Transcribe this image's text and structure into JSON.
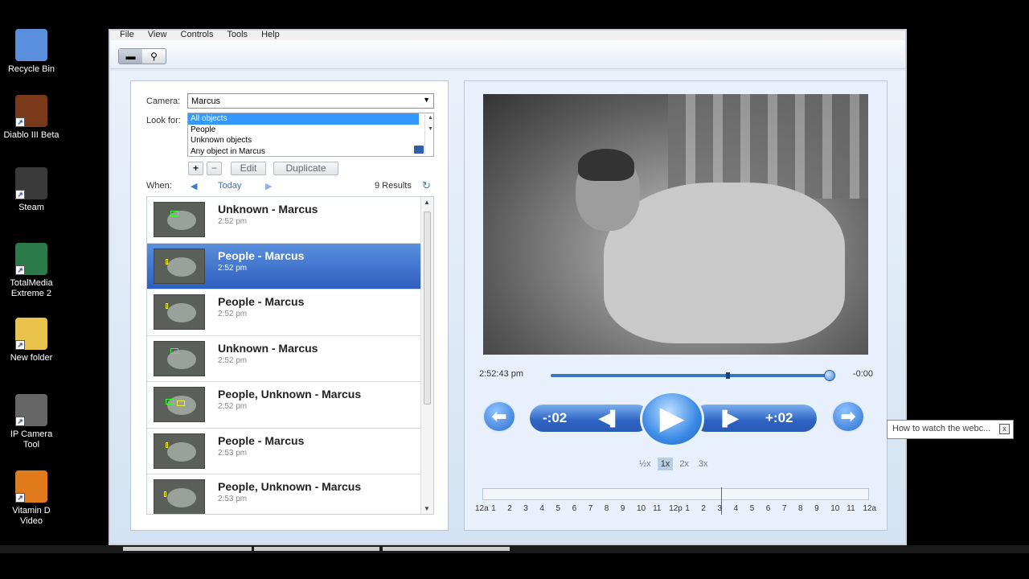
{
  "desktop_icons": [
    {
      "label": "Recycle Bin",
      "icon": "recycle-bin-icon",
      "color": "#5a8fdd"
    },
    {
      "label": "Diablo III Beta",
      "icon": "diablo-icon",
      "color": "#7a3a1a"
    },
    {
      "label": "Steam",
      "icon": "steam-icon",
      "color": "#3a3a3a"
    },
    {
      "label": "TotalMedia Extreme 2",
      "icon": "totalmedia-icon",
      "color": "#2a7a4a"
    },
    {
      "label": "New folder",
      "icon": "folder-icon",
      "color": "#e8c24a"
    },
    {
      "label": "IP Camera Tool",
      "icon": "ip-camera-tool-icon",
      "color": "#666"
    },
    {
      "label": "Vitamin D Video",
      "icon": "vitamin-d-icon",
      "color": "#e07a1a"
    }
  ],
  "menu": [
    "File",
    "View",
    "Controls",
    "Tools",
    "Help"
  ],
  "filters": {
    "camera_label": "Camera:",
    "camera_value": "Marcus",
    "lookfor_label": "Look for:",
    "lookfor_options": [
      "All objects",
      "People",
      "Unknown objects",
      "Any object in Marcus"
    ],
    "add": "+",
    "remove": "−",
    "edit": "Edit",
    "duplicate": "Duplicate",
    "when_label": "When:",
    "when_value": "Today",
    "results_count": "9 Results"
  },
  "events": [
    {
      "title": "Unknown - Marcus",
      "time": "2:52 pm"
    },
    {
      "title": "People - Marcus",
      "time": "2:52 pm"
    },
    {
      "title": "People - Marcus",
      "time": "2:52 pm"
    },
    {
      "title": "Unknown - Marcus",
      "time": "2:52 pm"
    },
    {
      "title": "People, Unknown - Marcus",
      "time": "2:52 pm"
    },
    {
      "title": "People - Marcus",
      "time": "2:53 pm"
    },
    {
      "title": "People, Unknown - Marcus",
      "time": "2:53 pm"
    }
  ],
  "player": {
    "current_time": "2:52:43 pm",
    "remaining": "-0:00",
    "progress": 1.0,
    "back_label": "-:02",
    "fwd_label": "+:02",
    "speeds": [
      "½x",
      "1x",
      "2x",
      "3x"
    ],
    "active_speed": "1x"
  },
  "timeline_hours": [
    "12a",
    "1",
    "2",
    "3",
    "4",
    "5",
    "6",
    "7",
    "8",
    "9",
    "10",
    "11",
    "12p",
    "1",
    "2",
    "3",
    "4",
    "5",
    "6",
    "7",
    "8",
    "9",
    "10",
    "11",
    "12a"
  ],
  "tooltip": "How to watch the webc..."
}
